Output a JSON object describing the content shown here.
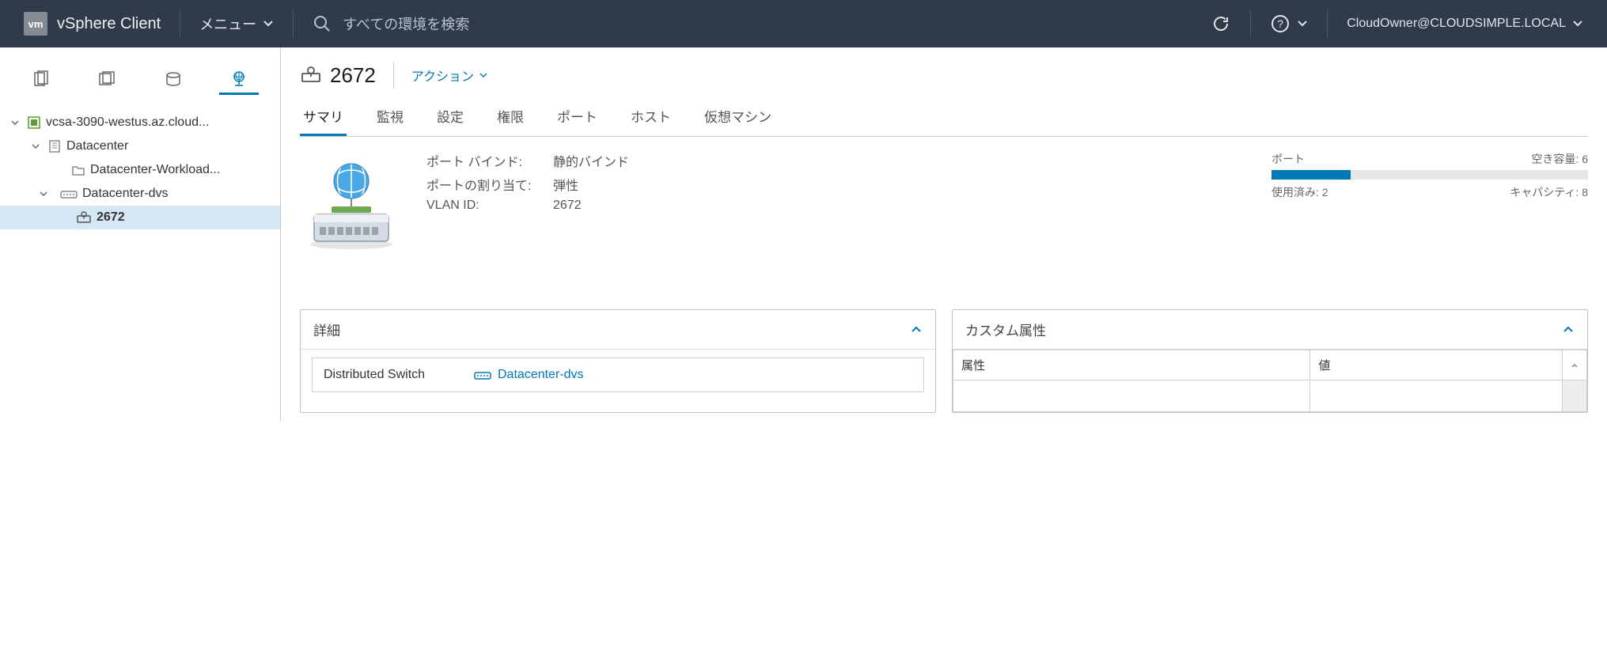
{
  "header": {
    "logo_text": "vm",
    "app_title": "vSphere Client",
    "menu_label": "メニュー",
    "search_placeholder": "すべての環境を検索",
    "user_label": "CloudOwner@CLOUDSIMPLE.LOCAL"
  },
  "tree": {
    "root": "vcsa-3090-westus.az.cloud...",
    "datacenter": "Datacenter",
    "workload": "Datacenter-Workload...",
    "dvs": "Datacenter-dvs",
    "portgroup": "2672"
  },
  "object": {
    "title": "2672",
    "actions_label": "アクション"
  },
  "tabs": {
    "summary": "サマリ",
    "monitor": "監視",
    "configure": "設定",
    "permissions": "権限",
    "ports": "ポート",
    "hosts": "ホスト",
    "vms": "仮想マシン"
  },
  "summary": {
    "port_binding_label": "ポート バインド:",
    "port_binding_value": "静的バインド",
    "port_alloc_label": "ポートの割り当て:",
    "port_alloc_value": "弾性",
    "vlan_label": "VLAN ID:",
    "vlan_value": "2672"
  },
  "capacity": {
    "title": "ポート",
    "free_label": "空き容量: 6",
    "used_label": "使用済み: 2",
    "cap_label": "キャパシティ: 8",
    "used": 2,
    "total": 8
  },
  "panels": {
    "details_title": "詳細",
    "details_label": "Distributed Switch",
    "details_link": "Datacenter-dvs",
    "custom_title": "カスタム属性",
    "col_attr": "属性",
    "col_val": "値"
  }
}
